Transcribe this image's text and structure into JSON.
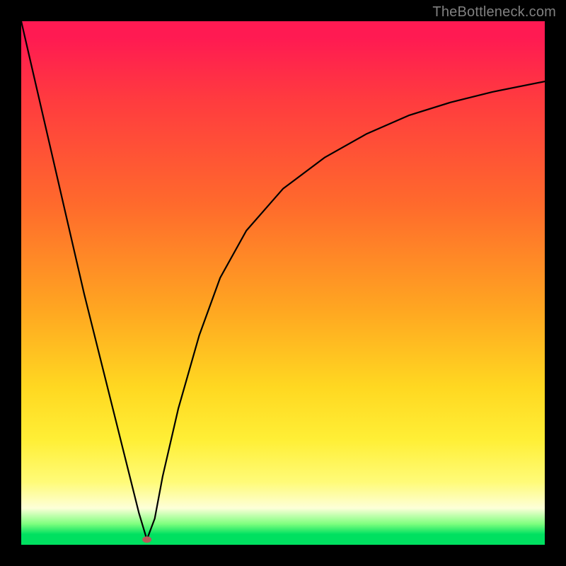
{
  "watermark": {
    "text": "TheBottleneck.com"
  },
  "chart_data": {
    "type": "line",
    "title": "",
    "xlabel": "",
    "ylabel": "",
    "xlim": [
      0,
      100
    ],
    "ylim": [
      0,
      100
    ],
    "grid": false,
    "legend": false,
    "series": [
      {
        "name": "bottleneck-curve",
        "x": [
          0,
          3,
          6,
          9,
          12,
          15,
          18,
          21,
          22.5,
          24,
          25.5,
          27,
          30,
          34,
          38,
          43,
          50,
          58,
          66,
          74,
          82,
          90,
          100
        ],
        "values": [
          100,
          87,
          74,
          61,
          48,
          36,
          24,
          12,
          6,
          1,
          5,
          13,
          26,
          40,
          51,
          60,
          68,
          74,
          78.5,
          82,
          84.5,
          86.5,
          88.5
        ]
      }
    ],
    "annotations": [
      {
        "name": "minimum-point",
        "x": 24,
        "y": 1
      }
    ],
    "gradient_stops": [
      {
        "pos": 0,
        "color": "#ff1a52"
      },
      {
        "pos": 35,
        "color": "#ff6a2c"
      },
      {
        "pos": 70,
        "color": "#ffd821"
      },
      {
        "pos": 93,
        "color": "#fdffd8"
      },
      {
        "pos": 100,
        "color": "#00e060"
      }
    ]
  }
}
